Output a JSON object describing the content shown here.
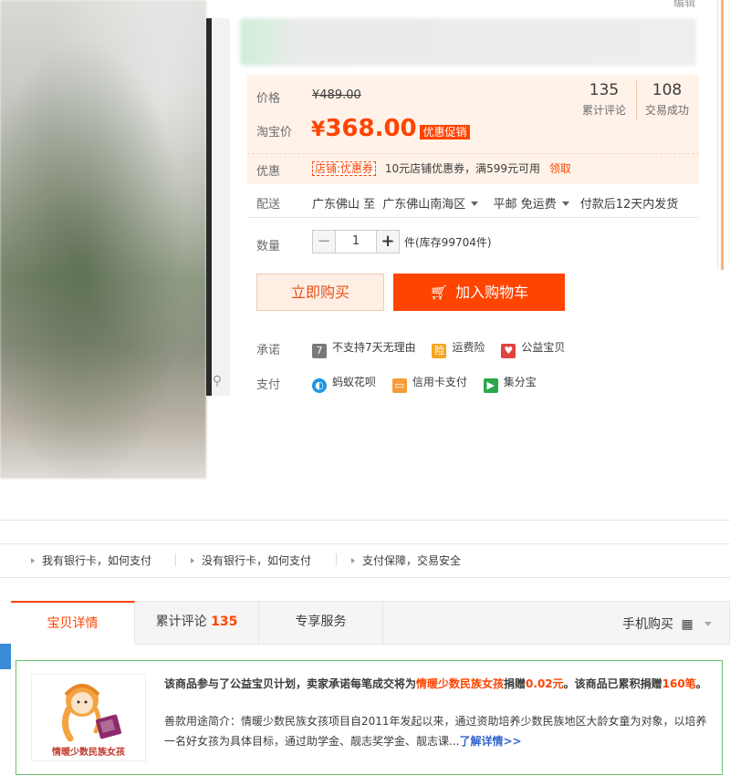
{
  "header": {
    "edit_label": "编辑"
  },
  "price": {
    "price_label": "价格",
    "original_price": "¥489.00",
    "taobao_label": "淘宝价",
    "yen": "¥",
    "taobao_price": "368.00",
    "promo_tag": "优惠促销",
    "reviews_count": "135",
    "reviews_label": "累计评论",
    "sales_count": "108",
    "sales_label": "交易成功"
  },
  "promo": {
    "label": "优惠",
    "coupon_tag": "店铺:优惠券",
    "coupon_text": "10元店铺优惠券，满599元可用",
    "receive_link": "领取"
  },
  "delivery": {
    "label": "配送",
    "from": "广东佛山 至",
    "to": "广东佛山南海区",
    "shipping": "平邮 免运费",
    "ship_time": "付款后12天内发货"
  },
  "quantity": {
    "label": "数量",
    "minus": "−",
    "value": "1",
    "plus": "+",
    "stock": "件(库存99704件)"
  },
  "actions": {
    "buy_now": "立即购买",
    "add_cart": "加入购物车"
  },
  "promise": {
    "label": "承诺",
    "items": [
      {
        "icon_text": "7",
        "label": "不支持7天无理由",
        "color": "#7a7a7a"
      },
      {
        "icon_text": "险",
        "label": "运费险",
        "color": "#f5a623"
      },
      {
        "icon_text": "♥",
        "label": "公益宝贝",
        "color": "#e0443e"
      }
    ]
  },
  "payment": {
    "label": "支付",
    "items": [
      {
        "icon_text": "◐",
        "label": "蚂蚁花呗",
        "color": "#1e96e0"
      },
      {
        "icon_text": "▭",
        "label": "信用卡支付",
        "color": "#f59d3a"
      },
      {
        "icon_text": "▶",
        "label": "集分宝",
        "color": "#2aa84a"
      }
    ]
  },
  "pay_help": [
    "我有银行卡，如何支付",
    "没有银行卡，如何支付",
    "支付保障，交易安全"
  ],
  "tabs": {
    "detail": "宝贝详情",
    "reviews": "累计评论",
    "reviews_count": "135",
    "service": "专享服务",
    "mobile_buy": "手机购买",
    "qr_icon": "▦"
  },
  "charity": {
    "logo_text": "情暖少数民族女孩",
    "line1_a": "该商品参与了公益宝贝计划，卖家承诺每笔成交将为",
    "line1_b": "情暖少数民族女孩",
    "line1_c": "捐赠",
    "line1_d": "0.02元",
    "line1_e": "。该商品已累积捐赠",
    "line1_f": "160笔",
    "line1_g": "。",
    "line2": "善款用途简介：情暖少数民族女孩项目自2011年发起以来，通过资助培养少数民族地区大龄女童为对象，以培养一名好女孩为具体目标，通过助学金、靓志奖学金、靓志课...",
    "more_link": "了解详情>>"
  }
}
